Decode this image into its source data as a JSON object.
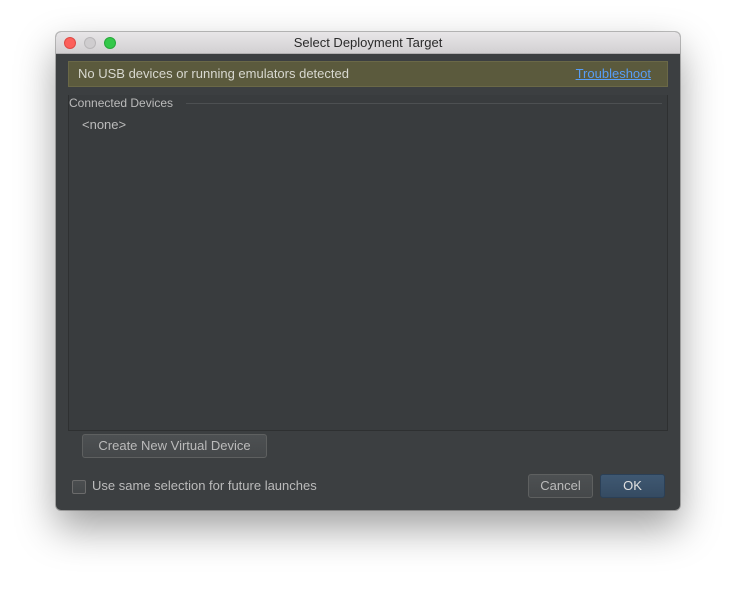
{
  "window": {
    "title": "Select Deployment Target"
  },
  "banner": {
    "message": "No USB devices or running emulators detected",
    "link_label": "Troubleshoot"
  },
  "connected_devices": {
    "title": "Connected Devices",
    "items": [
      "<none>"
    ]
  },
  "buttons": {
    "create_virtual_device": "Create New Virtual Device",
    "cancel": "Cancel",
    "ok": "OK"
  },
  "options": {
    "same_selection_label": "Use same selection for future launches",
    "same_selection_checked": false
  },
  "colors": {
    "window_bg": "#3c3f41",
    "banner_bg": "#5b5a3d",
    "link": "#589df6",
    "ok_button": "#3f5872",
    "close_button": "#fc605b",
    "zoom_button": "#34c84a"
  },
  "icons": {
    "close": "close-icon",
    "minimize": "minimize-icon",
    "zoom": "zoom-icon"
  }
}
